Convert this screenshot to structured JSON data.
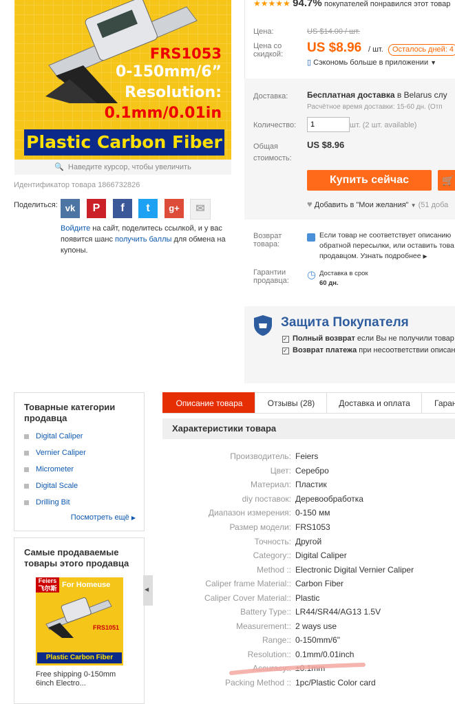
{
  "product": {
    "image_text": {
      "model": "FRS1053",
      "range": "0-150mm/6”",
      "resolution_label": "Resolution:",
      "resolution_value": "0.1mm/0.01in",
      "banner": "Plastic Carbon Fiber"
    },
    "zoom_hint": "Наведите курсор, чтобы увеличить",
    "id_text": "Идентификатор товара 1866732826"
  },
  "share": {
    "label": "Поделиться:",
    "icons": [
      "vk-icon",
      "pinterest-icon",
      "facebook-icon",
      "twitter-icon",
      "google-plus-icon",
      "email-icon"
    ],
    "join_link": "Войдите",
    "text1": " на сайт, поделитесь ссылкой, и у вас появится шанс ",
    "points_link": "получить баллы",
    "text2": " для обмена на купоны."
  },
  "rating": {
    "percent": "94.7%",
    "text": "покупателей понравился этот товар"
  },
  "price": {
    "price_label": "Цена:",
    "old_price": "US $14.00 / шт.",
    "discount_label": "Цена со скидкой:",
    "new_price": "US $8.96",
    "unit": "/ шт.",
    "days_left": "Осталось дней: 4",
    "app_saving": "Сэкономь больше в приложении"
  },
  "shipping": {
    "label": "Доставка:",
    "free": "Бесплатная доставка",
    "to": " в Belarus слу",
    "time": "Расчётное время доставки: 15-60 дн. (Отп",
    "qty_label": "Количество:",
    "qty_value": "1",
    "qty_avail": "шт. (2 шт. available)",
    "total_label": "Общая стоимость:",
    "total": "US $8.96",
    "buy_now": "Купить сейчас",
    "wishlist": "Добавить в \"Мои желания\"",
    "wish_count": "(51 доба"
  },
  "returns": {
    "label": "Возврат товара:",
    "text": "Если товар не соответствует описанию обратной пересылки, или оставить това продавцом. Узнать подробнее",
    "guarantee_label": "Гарантии продавца:",
    "guarantee_text": "Доставка в срок",
    "guarantee_days": "60 дн."
  },
  "protection": {
    "title": "Защита Покупателя",
    "item1_bold": "Полный возврат",
    "item1_rest": " если Вы не получили товар",
    "item2_bold": "Возврат платежа",
    "item2_rest": " при несоответствии описан"
  },
  "sidebar": {
    "categories_title": "Товарные категории продавца",
    "categories": [
      "Digital Caliper",
      "Vernier Caliper",
      "Micrometer",
      "Digital Scale",
      "Drilling Bit"
    ],
    "see_more": "Посмотреть ещё",
    "bestsellers_title": "Самые продаваемые товары этого продавца",
    "best_item_title": "Free shipping 0-150mm 6inch Electro...",
    "best_img": {
      "brand": "Feiers",
      "brand_cn": "飞尔斯",
      "tag": "For Homeuse",
      "model": "FRS1051",
      "banner": "Plastic Carbon Fiber"
    }
  },
  "tabs": [
    "Описание товара",
    "Отзывы (28)",
    "Доставка и оплата",
    "Гаран"
  ],
  "specs_title": "Характеристики товара",
  "specs": [
    {
      "k": "Производитель:",
      "v": "Feiers"
    },
    {
      "k": "Цвет:",
      "v": "Серебро"
    },
    {
      "k": "Материал:",
      "v": "Пластик"
    },
    {
      "k": "diy поставок:",
      "v": "Деревообработка"
    },
    {
      "k": "Диапазон измерения:",
      "v": "0-150 мм"
    },
    {
      "k": "Размер модели:",
      "v": "FRS1053"
    },
    {
      "k": "Точность:",
      "v": "Другой"
    },
    {
      "k": "Category::",
      "v": "Digital Caliper"
    },
    {
      "k": "Method ::",
      "v": "Electronic Digital Vernier Caliper"
    },
    {
      "k": "Caliper frame Material::",
      "v": "Carbon Fiber"
    },
    {
      "k": "Caliper Cover Material::",
      "v": "Plastic"
    },
    {
      "k": "Battery Type::",
      "v": "LR44/SR44/AG13 1.5V"
    },
    {
      "k": "Measurement::",
      "v": "2 ways use"
    },
    {
      "k": "Range::",
      "v": "0-150mm/6\""
    },
    {
      "k": "Resolution::",
      "v": "0.1mm/0.01inch"
    },
    {
      "k": "Accuracy::",
      "v": "±0.1mm"
    },
    {
      "k": "Packing Method ::",
      "v": "1pc/Plastic Color card"
    }
  ]
}
